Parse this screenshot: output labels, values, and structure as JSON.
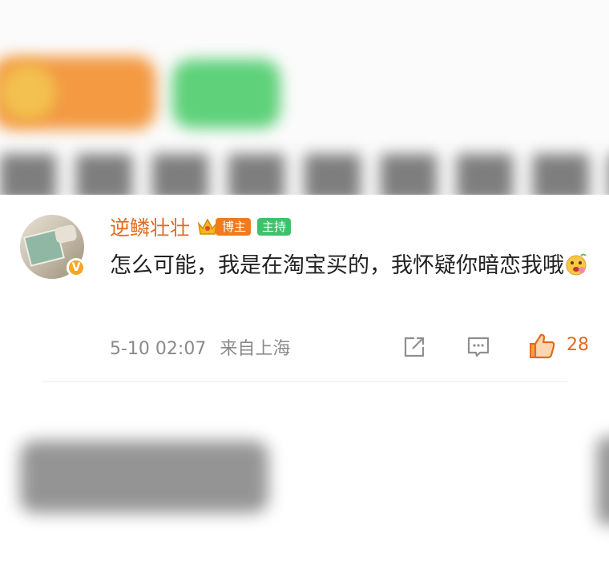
{
  "comment": {
    "username": "逆鳞壮壮",
    "badges": {
      "blogger": "博主",
      "host": "主持"
    },
    "content": "怎么可能，我是在淘宝买的，我怀疑你暗恋我哦",
    "timestamp": "5-10 02:07",
    "location": "来自上海",
    "likes": "28",
    "verified_mark": "V"
  },
  "colors": {
    "username": "#e36a1c",
    "blogger_badge": "#f07a1e",
    "host_badge": "#3fc16a",
    "like": "#e36a1c",
    "meta_text": "#8a8a8a"
  },
  "icons": [
    "crown-icon",
    "verified-badge-icon",
    "emoji-icon",
    "share-icon",
    "comment-icon",
    "like-icon"
  ]
}
